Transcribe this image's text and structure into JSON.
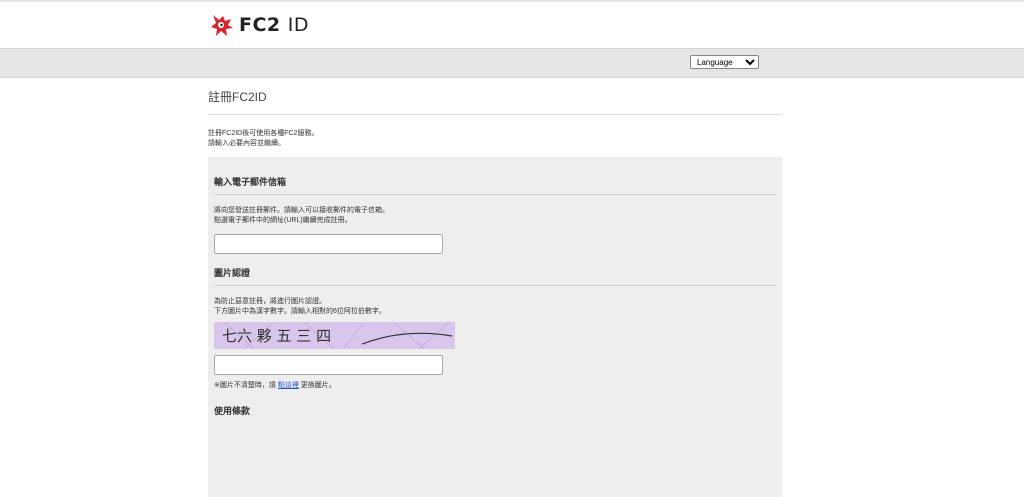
{
  "header": {
    "logo_main": "FC2",
    "logo_suffix": "ID"
  },
  "language": {
    "selected": "Language"
  },
  "page": {
    "title": "註冊FC2ID",
    "intro_line1": "註冊FC2ID後可使用各種FC2服務。",
    "intro_line2": "請輸入必要內容並繼續。"
  },
  "email_section": {
    "title": "輸入電子郵件信箱",
    "desc_line1": "將向您發送註冊郵件。請輸入可以接收郵件的電子信箱。",
    "desc_line2": "點選電子郵件中的網址(URL)繼續完成註冊。",
    "input_value": ""
  },
  "captcha_section": {
    "title": "圖片認證",
    "desc_line1": "為防止惡意註冊，將進行圖片認證。",
    "desc_line2": "下方圖片中為漢字數字。請輸入相對的6位阿拉伯數字。",
    "captcha_text": "七六 夥 五 三 四",
    "input_value": "",
    "note_prefix": "※圖片不清楚時，請",
    "note_link": "點這裡",
    "note_suffix": "更換圖片。"
  },
  "terms_section": {
    "title": "使用條款"
  },
  "colors": {
    "panel_bg": "#eeeeee",
    "lang_bar_bg": "#e5e5e5",
    "logo_red": "#d7262e",
    "link": "#2255cc",
    "captcha_bg": "#d9c6ec"
  }
}
